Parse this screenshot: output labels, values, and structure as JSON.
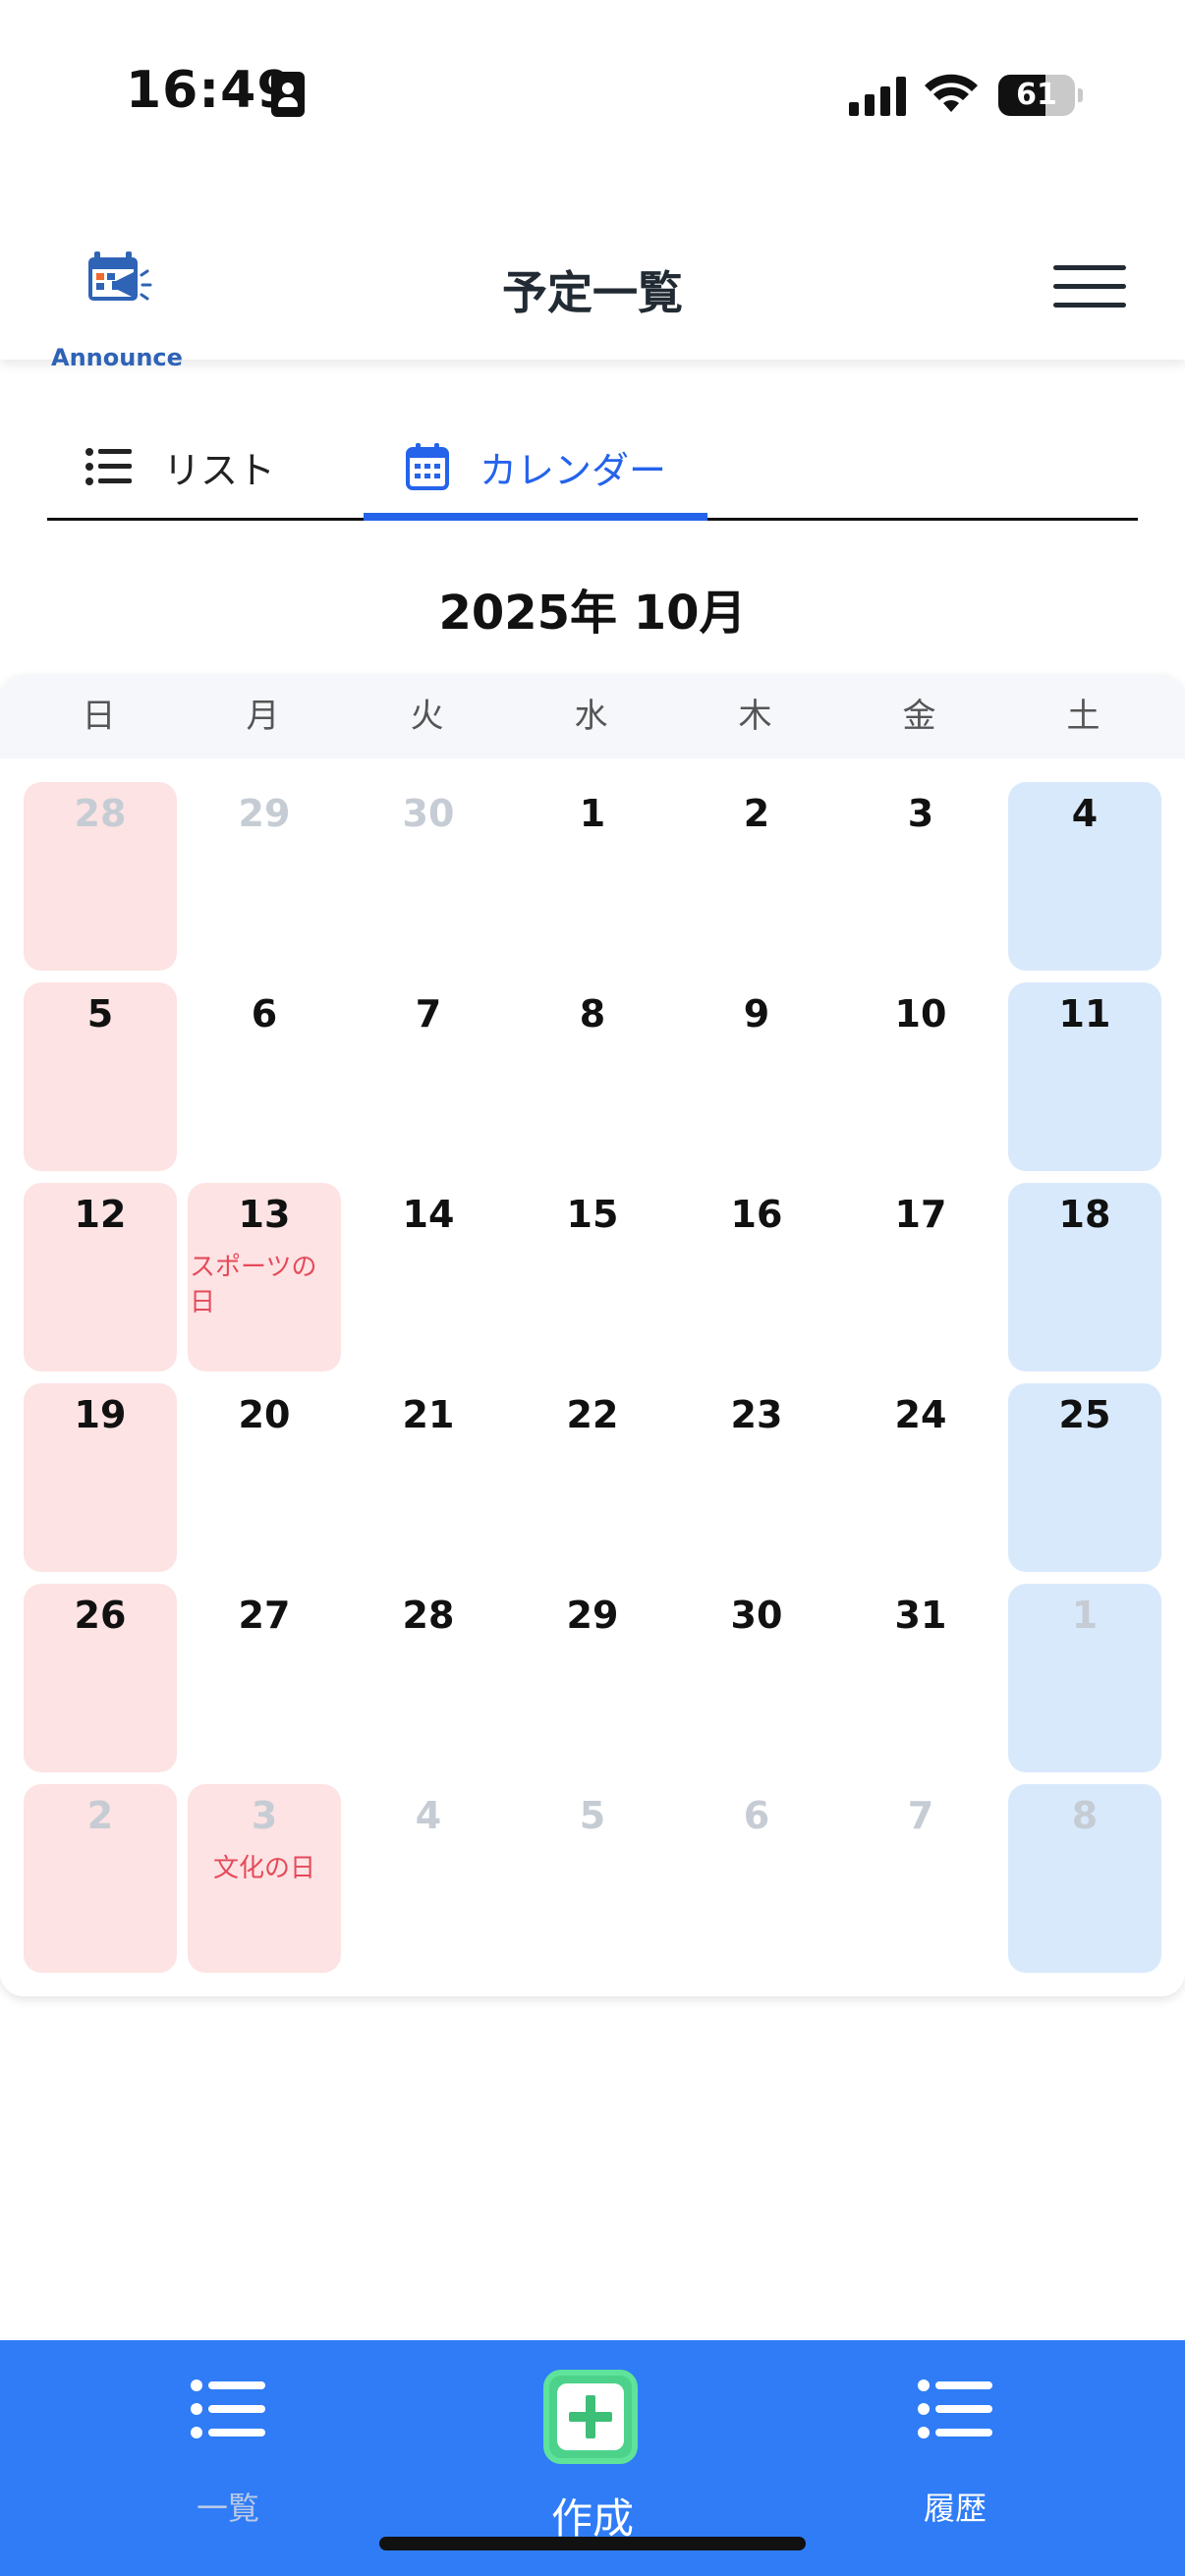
{
  "status_bar": {
    "time": "16:49",
    "battery": "61",
    "battery_level": 0.61
  },
  "header": {
    "logo_text": "Announce",
    "title": "予定一覧"
  },
  "tabs": [
    {
      "label": "リスト",
      "active": false
    },
    {
      "label": "カレンダー",
      "active": true
    }
  ],
  "calendar": {
    "month_title": "2025年 10月",
    "weekdays": [
      "日",
      "月",
      "火",
      "水",
      "木",
      "金",
      "土"
    ],
    "weeks": [
      [
        {
          "day": "28",
          "dim": true
        },
        {
          "day": "29",
          "dim": true
        },
        {
          "day": "30",
          "dim": true
        },
        {
          "day": "1"
        },
        {
          "day": "2"
        },
        {
          "day": "3"
        },
        {
          "day": "4"
        }
      ],
      [
        {
          "day": "5"
        },
        {
          "day": "6"
        },
        {
          "day": "7"
        },
        {
          "day": "8"
        },
        {
          "day": "9"
        },
        {
          "day": "10"
        },
        {
          "day": "11"
        }
      ],
      [
        {
          "day": "12"
        },
        {
          "day": "13",
          "event": "スポーツの日"
        },
        {
          "day": "14"
        },
        {
          "day": "15"
        },
        {
          "day": "16"
        },
        {
          "day": "17"
        },
        {
          "day": "18"
        }
      ],
      [
        {
          "day": "19"
        },
        {
          "day": "20"
        },
        {
          "day": "21"
        },
        {
          "day": "22"
        },
        {
          "day": "23"
        },
        {
          "day": "24"
        },
        {
          "day": "25"
        }
      ],
      [
        {
          "day": "26"
        },
        {
          "day": "27"
        },
        {
          "day": "28"
        },
        {
          "day": "29"
        },
        {
          "day": "30"
        },
        {
          "day": "31"
        },
        {
          "day": "1",
          "dim": true
        }
      ],
      [
        {
          "day": "2",
          "dim": true
        },
        {
          "day": "3",
          "dim": true,
          "event": "文化の日"
        },
        {
          "day": "4",
          "dim": true
        },
        {
          "day": "5",
          "dim": true
        },
        {
          "day": "6",
          "dim": true
        },
        {
          "day": "7",
          "dim": true
        },
        {
          "day": "8",
          "dim": true
        }
      ]
    ]
  },
  "bottom_nav": {
    "list_label": "一覧",
    "create_label": "作成",
    "history_label": "履歴"
  },
  "colors": {
    "accent": "#2563eb",
    "nav_bg": "#2f7cf6",
    "sunday_bg": "#fde3e3",
    "saturday_bg": "#d9e9fc",
    "holiday_text": "#e54a5a",
    "create_green": "#4cd28a"
  }
}
